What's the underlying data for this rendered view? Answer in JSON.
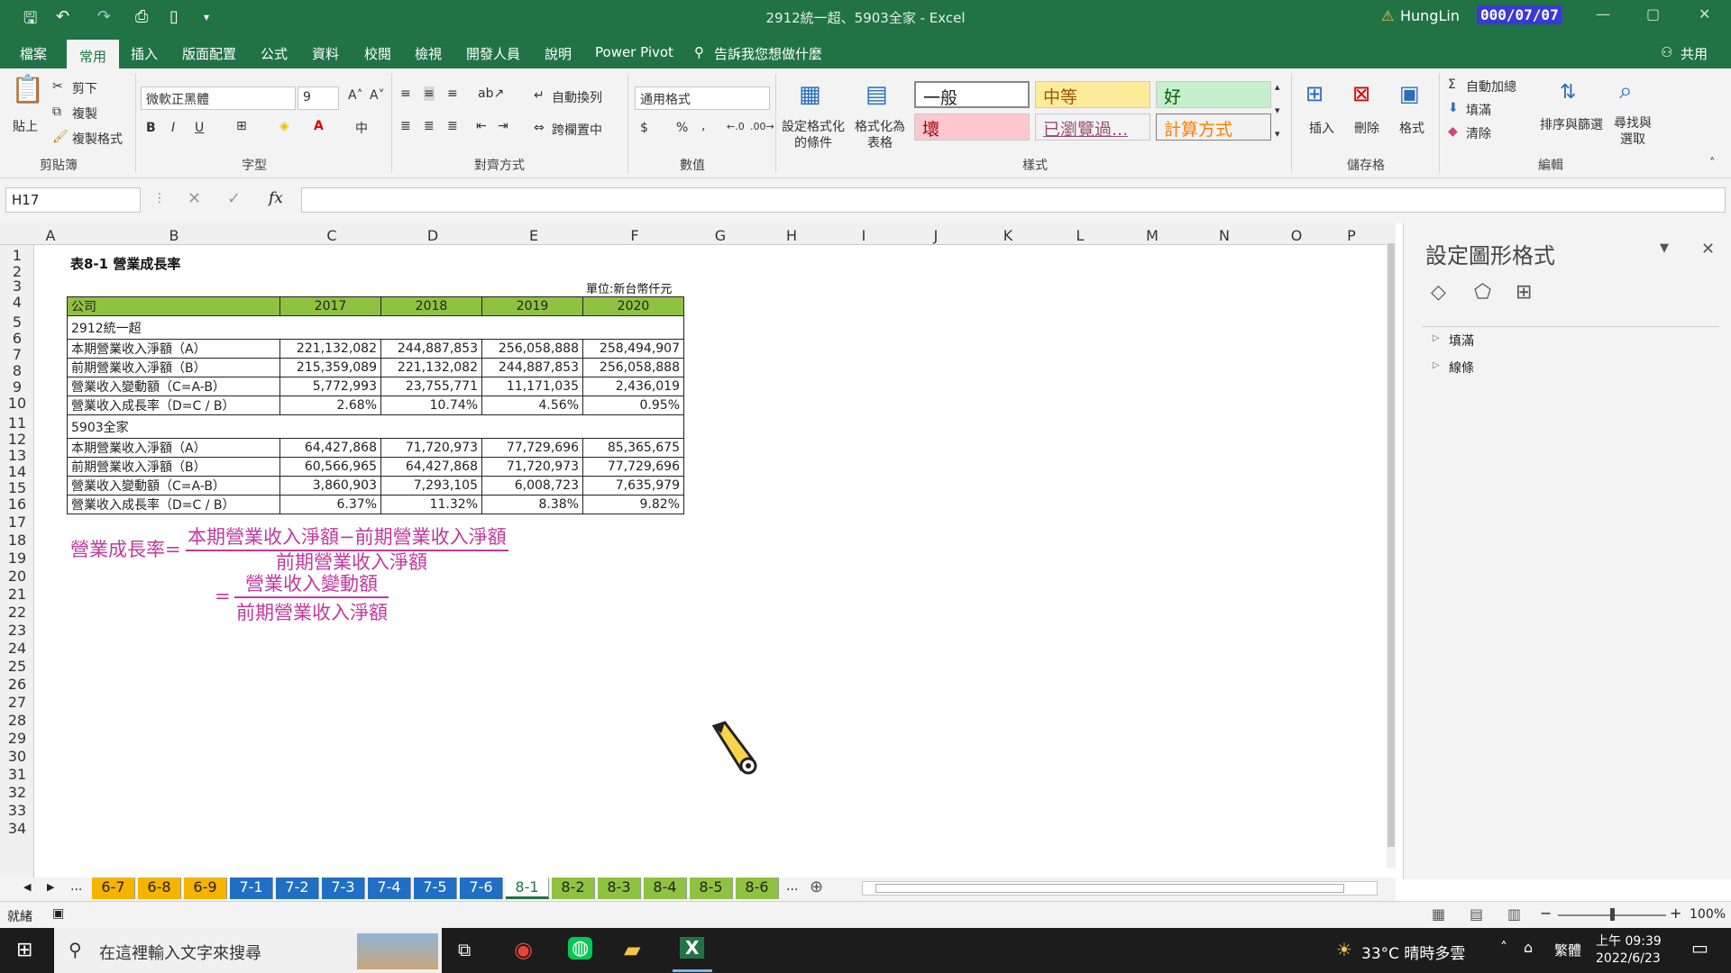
{
  "window": {
    "title": "2912統一超、5903全家 - Excel",
    "user": "HungLin",
    "date_badge": "000/07/07"
  },
  "quick_access": {
    "save_icon": "save-icon",
    "undo_icon": "undo-icon",
    "redo_icon": "redo-icon"
  },
  "menu": [
    "檔案",
    "常用",
    "插入",
    "版面配置",
    "公式",
    "資料",
    "校閱",
    "檢視",
    "開發人員",
    "說明",
    "Power Pivot",
    "告訴我您想做什麼"
  ],
  "share_label": "共用",
  "ribbon": {
    "clipboard": {
      "paste": "貼上",
      "cut": "剪下",
      "copy": "複製",
      "format_painter": "複製格式",
      "label": "剪貼簿"
    },
    "font": {
      "name": "微軟正黑體",
      "size": "9",
      "bold": "B",
      "italic": "I",
      "underline": "U",
      "label": "字型"
    },
    "align": {
      "wrap": "自動換列",
      "merge": "跨欄置中",
      "label": "對齊方式"
    },
    "number": {
      "format": "通用格式",
      "currency": "$",
      "percent": "%",
      "comma": ",",
      "label": "數值"
    },
    "styles": {
      "cond": "設定格式化的條件",
      "table": "格式化為表格",
      "normal": "一般",
      "neutral": "中等",
      "good": "好",
      "bad": "壞",
      "visited": "已瀏覽過...",
      "calc": "計算方式",
      "label": "樣式"
    },
    "cells": {
      "insert": "插入",
      "delete": "刪除",
      "format": "格式",
      "label": "儲存格"
    },
    "edit": {
      "autosum": "自動加總",
      "fill": "填滿",
      "clear": "清除",
      "sort": "排序與篩選",
      "find": "尋找與選取",
      "label": "編輯"
    }
  },
  "formula_bar": {
    "namebox": "H17",
    "fx": "fx",
    "value": ""
  },
  "columns": [
    "A",
    "B",
    "C",
    "D",
    "E",
    "F",
    "G",
    "H",
    "I",
    "J",
    "K",
    "L",
    "M",
    "N",
    "O",
    "P"
  ],
  "rows": [
    "1",
    "2",
    "3",
    "4",
    "5",
    "6",
    "7",
    "8",
    "9",
    "10",
    "11",
    "12",
    "13",
    "14",
    "15",
    "16",
    "17",
    "18",
    "19",
    "20",
    "21",
    "22",
    "23",
    "24",
    "25",
    "26",
    "27",
    "28",
    "29",
    "30",
    "31",
    "32",
    "33",
    "34"
  ],
  "sheet": {
    "title": "表8-1 營業成長率",
    "unit": "單位:新台幣仟元",
    "header": [
      "公司",
      "2017",
      "2018",
      "2019",
      "2020"
    ],
    "company1": "2912統一超",
    "rows1": [
      [
        "本期營業收入淨額（A）",
        "221,132,082",
        "244,887,853",
        "256,058,888",
        "258,494,907"
      ],
      [
        "前期營業收入淨額（B）",
        "215,359,089",
        "221,132,082",
        "244,887,853",
        "256,058,888"
      ],
      [
        "營業收入變動額（C=A-B）",
        "5,772,993",
        "23,755,771",
        "11,171,035",
        "2,436,019"
      ],
      [
        "營業收入成長率（D=C / B）",
        "2.68%",
        "10.74%",
        "4.56%",
        "0.95%"
      ]
    ],
    "company2": "5903全家",
    "rows2": [
      [
        "本期營業收入淨額（A）",
        "64,427,868",
        "71,720,973",
        "77,729,696",
        "85,365,675"
      ],
      [
        "前期營業收入淨額（B）",
        "60,566,965",
        "64,427,868",
        "71,720,973",
        "77,729,696"
      ],
      [
        "營業收入變動額（C=A-B）",
        "3,860,903",
        "7,293,105",
        "6,008,723",
        "7,635,979"
      ],
      [
        "營業收入成長率（D=C / B）",
        "6.37%",
        "11.32%",
        "8.38%",
        "9.82%"
      ]
    ],
    "formula": {
      "lhs": "營業成長率=",
      "num1": "本期營業收入淨額−前期營業收入淨額",
      "den1": "前期營業收入淨額",
      "eq": "=",
      "num2": "營業收入變動額",
      "den2": "前期營業收入淨額"
    }
  },
  "pane": {
    "title": "設定圖形格式",
    "fill": "填滿",
    "line": "線條"
  },
  "sheet_tabs": [
    {
      "name": "6-7",
      "color": "#f6b400"
    },
    {
      "name": "6-8",
      "color": "#f6b400"
    },
    {
      "name": "6-9",
      "color": "#f6b400"
    },
    {
      "name": "7-1",
      "color": "#1f6fc5"
    },
    {
      "name": "7-2",
      "color": "#1f6fc5"
    },
    {
      "name": "7-3",
      "color": "#1f6fc5"
    },
    {
      "name": "7-4",
      "color": "#1f6fc5"
    },
    {
      "name": "7-5",
      "color": "#1f6fc5"
    },
    {
      "name": "7-6",
      "color": "#1f6fc5"
    },
    {
      "name": "8-1",
      "color": "#ffffff"
    },
    {
      "name": "8-2",
      "color": "#8fc241"
    },
    {
      "name": "8-3",
      "color": "#8fc241"
    },
    {
      "name": "8-4",
      "color": "#8fc241"
    },
    {
      "name": "8-5",
      "color": "#8fc241"
    },
    {
      "name": "8-6",
      "color": "#8fc241"
    }
  ],
  "status": {
    "ready": "就緒",
    "zoom": "100%"
  },
  "taskbar": {
    "search": "在這裡輸入文字來搜尋",
    "weather": "33°C 晴時多雲",
    "ime": "繁體",
    "time": "上午 09:39",
    "date": "2022/6/23"
  }
}
